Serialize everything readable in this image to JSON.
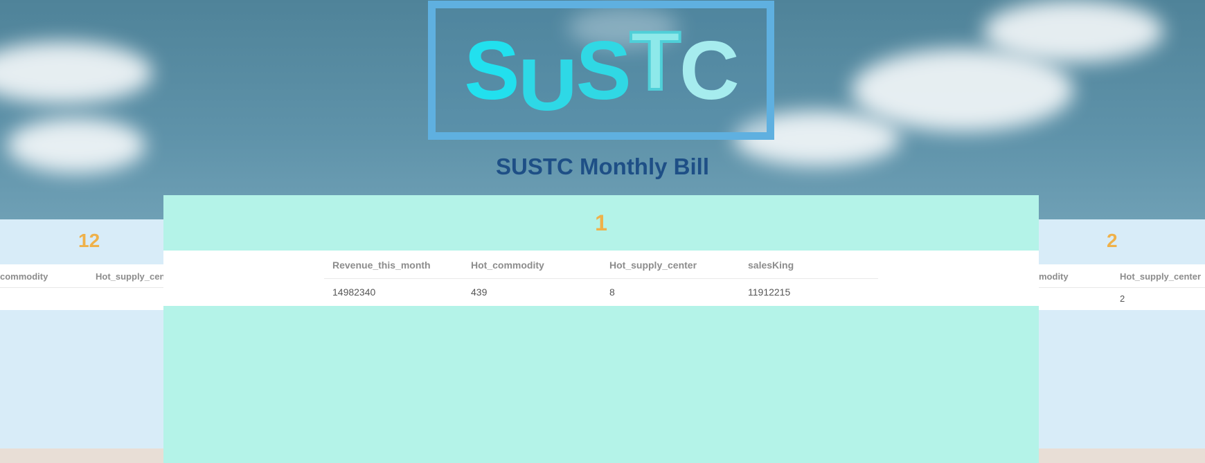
{
  "logo": {
    "letters": [
      "S",
      "U",
      "S",
      "T",
      "C"
    ]
  },
  "page": {
    "title": "SUSTC Monthly Bill"
  },
  "left_card": {
    "month": "12",
    "columns": [
      "commodity",
      "Hot_supply_cente"
    ]
  },
  "main_card": {
    "month": "1",
    "columns": [
      "Revenue_this_month",
      "Hot_commodity",
      "Hot_supply_center",
      "salesKing"
    ],
    "row": [
      "14982340",
      "439",
      "8",
      "11912215"
    ]
  },
  "right_card": {
    "month": "2",
    "columns": [
      "modity",
      "Hot_supply_center"
    ],
    "row": [
      "",
      "2"
    ]
  },
  "colors": {
    "month_number": "#efb14a",
    "title": "#1e4f86",
    "main_card_bg": "#b4f3e8",
    "side_card_bg": "#d8ecf8",
    "logo_frame": "#5fb0e0"
  }
}
